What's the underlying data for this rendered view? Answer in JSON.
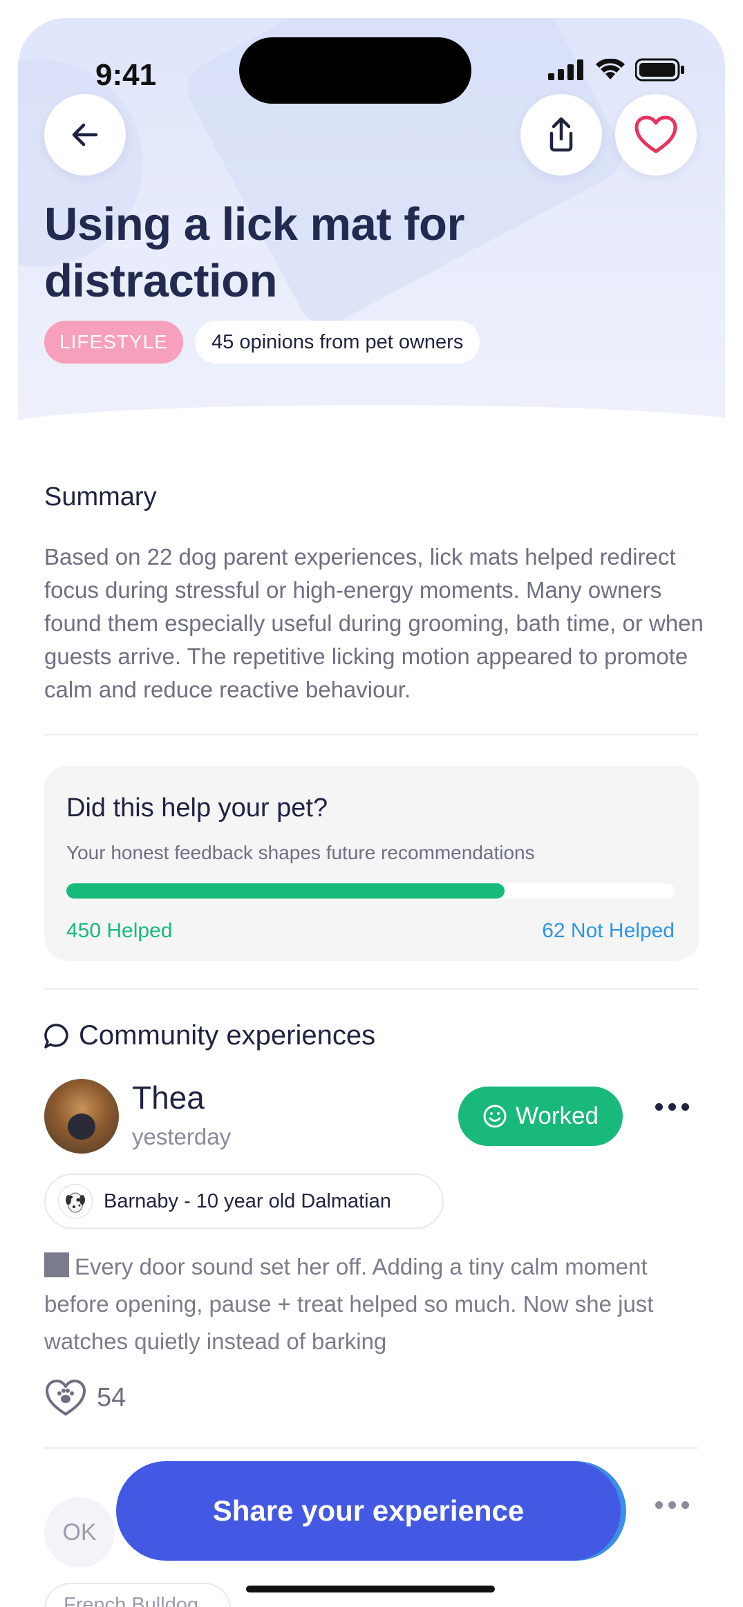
{
  "status_bar": {
    "time": "9:41"
  },
  "header": {
    "title": "Using a lick mat for distraction",
    "tag": "LIFESTYLE",
    "opinions": "45 opinions from pet owners"
  },
  "summary": {
    "heading": "Summary",
    "text": "Based on 22 dog parent experiences, lick mats helped redirect focus during stressful or high-energy moments. Many owners found them especially useful during grooming, bath time, or when guests arrive. The repetitive licking motion appeared to promote calm and reduce reactive behaviour."
  },
  "feedback": {
    "title": "Did this help your pet?",
    "subtitle": "Your honest feedback shapes future recommendations",
    "helped_label": "450 Helped",
    "not_helped_label": "62 Not Helped",
    "helped_fraction": 0.72
  },
  "community": {
    "heading": "Community experiences",
    "post": {
      "user": "Thea",
      "time": "yesterday",
      "badge": "Worked",
      "pet": "Barnaby - 10 year old Dalmatian",
      "text": "Every door sound set her off. Adding a tiny calm moment before opening, pause + treat helped so much. Now she just watches quietly instead of barking",
      "likes": "54"
    },
    "next_post": {
      "avatar_initials": "OK",
      "pet_partial": "French Bulldog"
    }
  },
  "cta": {
    "label": "Share your experience"
  },
  "colors": {
    "accent": "#4359e3",
    "success": "#17ba7b",
    "info": "#2a96e8",
    "tag": "#f6a0bb",
    "heart": "#e8335e"
  }
}
